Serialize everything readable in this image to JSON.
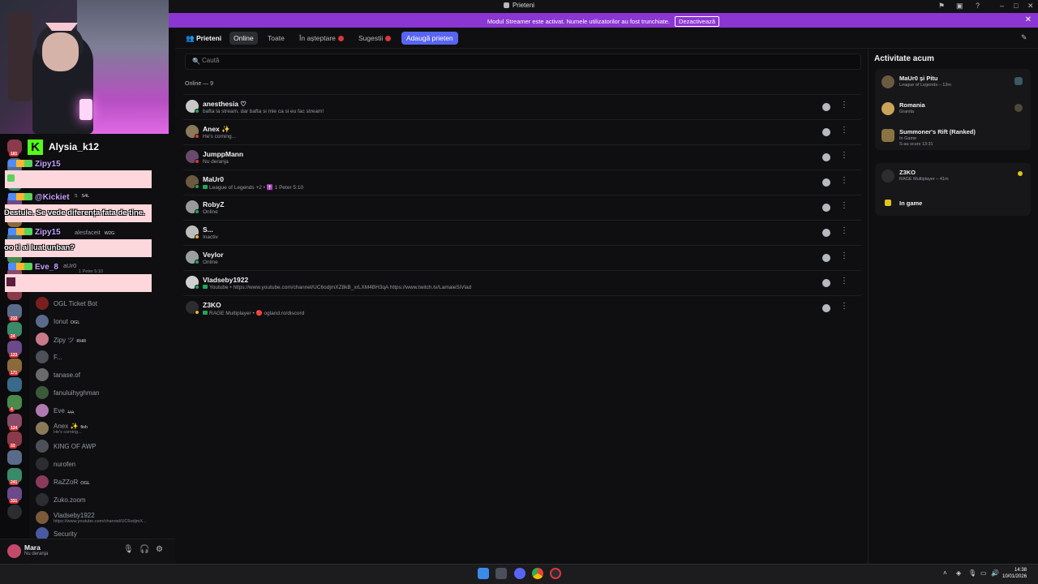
{
  "window": {
    "title": "Prieteni"
  },
  "banner": {
    "text": "Modul Streamer este activat. Numele utilizatorilor au fost trunchiate.",
    "button": "Dezactivează"
  },
  "overlay": {
    "kick_user": "Alysia_k12",
    "chat": [
      {
        "name": "Zipy15",
        "message": ""
      },
      {
        "name": "@Kickiet",
        "message": "Destule. Se vede diferența fata de tine."
      },
      {
        "name": "Zipy15",
        "message": "oo ti ai luat unban?"
      },
      {
        "name": "Eve_8",
        "message": ""
      }
    ]
  },
  "servers": [
    {
      "count": "181"
    },
    {
      "count": ""
    },
    {
      "count": ""
    },
    {
      "count": ""
    },
    {
      "count": ""
    },
    {
      "count": ""
    },
    {
      "count": ""
    },
    {
      "count": ""
    },
    {
      "count": ""
    },
    {
      "count": "232"
    },
    {
      "count": "24"
    },
    {
      "count": "123"
    },
    {
      "count": "171"
    },
    {
      "count": ""
    },
    {
      "count": "4"
    },
    {
      "count": "124"
    },
    {
      "count": "33"
    },
    {
      "count": ""
    },
    {
      "count": "241"
    },
    {
      "count": "331"
    },
    {
      "count": ""
    }
  ],
  "dms": [
    {
      "name": "OGL Ticket Bot",
      "tag": "",
      "sub": ""
    },
    {
      "name": "Ionut",
      "tag": "OGL",
      "sub": ""
    },
    {
      "name": "Zipy ツ",
      "tag": "RHR",
      "sub": ""
    },
    {
      "name": "F...",
      "tag": "",
      "sub": ""
    },
    {
      "name": "tanase.of",
      "tag": "",
      "sub": ""
    },
    {
      "name": "fanuluihyghman",
      "tag": "",
      "sub": ""
    },
    {
      "name": "Eve",
      "tag": "ܔܔܔ",
      "sub": ""
    },
    {
      "name": "Anex ✨",
      "tag": "fish",
      "sub": "He's coming..."
    },
    {
      "name": "KING OF AWP",
      "tag": "",
      "sub": ""
    },
    {
      "name": "nurofen",
      "tag": "",
      "sub": ""
    },
    {
      "name": "RaZZoR",
      "tag": "OGL",
      "sub": ""
    },
    {
      "name": "Zuko.zoom",
      "tag": "",
      "sub": ""
    },
    {
      "name": "Vladseby1922",
      "tag": "",
      "sub": "https://www.youtube.com/channel/UC6odjmX..."
    },
    {
      "name": "Security",
      "tag": "",
      "sub": ""
    }
  ],
  "partial_dms": {
    "s": "s",
    "s_tag": "S4L",
    "alesfaceit": "alesfaceit",
    "alesfaceit_tag": "W2G",
    "maur0": "aUr0",
    "maur0_sub": "1 Peter 5:10"
  },
  "user": {
    "name": "Mara",
    "status": "Nu deranja"
  },
  "tabs": {
    "friends": "Prieteni",
    "online": "Online",
    "all": "Toate",
    "pending": "În așteptare",
    "suggestions": "Sugestii",
    "add": "Adaugă prieten"
  },
  "search": {
    "placeholder": "Caută"
  },
  "online_header": "Online — 9",
  "friends": [
    {
      "name": "anesthesia ♡",
      "sub": "bafta la stream. dar bafta si mie ca si eu fac stream!",
      "status_color": "#23a559",
      "game": false
    },
    {
      "name": "Anex ✨",
      "sub": "He's coming...",
      "status_color": "#da373c",
      "game": false
    },
    {
      "name": "JumppMann",
      "sub": "Nu deranja",
      "status_color": "#da373c",
      "game": false
    },
    {
      "name": "MaUr0",
      "sub": "League of Legends +2 • ✝️ 1 Peter 5:10",
      "status_color": "#23a559",
      "game": true
    },
    {
      "name": "RobyZ",
      "sub": "Online",
      "status_color": "#23a559",
      "game": false
    },
    {
      "name": "S...",
      "sub": "Inactiv",
      "status_color": "#f0b232",
      "game": false
    },
    {
      "name": "Veylor",
      "sub": "Online",
      "status_color": "#23a559",
      "game": false
    },
    {
      "name": "Vladseby1922",
      "sub": "Youtube • https://www.youtube.com/channel/UC6odjmXZ8kB_xrLXM4BH3qA https://www.twitch.tv/LamaieSiVlad",
      "status_color": "#23a559",
      "game": true
    },
    {
      "name": "Z3KO",
      "sub": "RAGE Multiplayer • 🔴 ogland.ro/discord",
      "status_color": "#f0b232",
      "game": true
    }
  ],
  "activity": {
    "title": "Activitate acum",
    "card1": [
      {
        "name": "MaUr0 și Pitu",
        "sub": "League of Legends – 13m",
        "sub2": ""
      },
      {
        "name": "Romania",
        "sub": "Granita",
        "sub2": ""
      },
      {
        "name": "Summoner's Rift (Ranked)",
        "sub": "In Game",
        "sub2": "S-au scurs 13:31"
      }
    ],
    "card2": [
      {
        "name": "Z3KO",
        "sub": "RAGE Multiplayer – 41m",
        "sub2": ""
      },
      {
        "name": "In game",
        "sub": "",
        "sub2": ""
      }
    ]
  },
  "clock": {
    "time": "14:38",
    "date": "10/01/2026"
  },
  "colors": {
    "accent": "#5865f2",
    "banner": "#8b35d3",
    "online": "#23a559",
    "dnd": "#da373c",
    "idle": "#f0b232"
  }
}
